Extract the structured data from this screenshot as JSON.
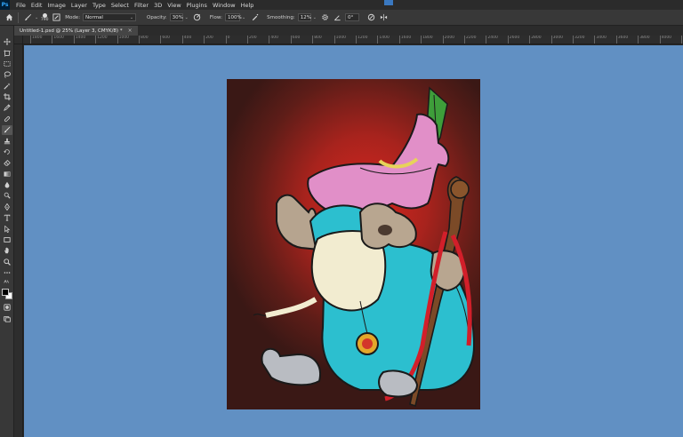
{
  "app": {
    "logo": "Ps"
  },
  "menu": [
    "File",
    "Edit",
    "Image",
    "Layer",
    "Type",
    "Select",
    "Filter",
    "3D",
    "View",
    "Plugins",
    "Window",
    "Help"
  ],
  "options": {
    "brush_size": "790",
    "mode_label": "Mode:",
    "mode_value": "Normal",
    "opacity_label": "Opacity:",
    "opacity_value": "30%",
    "flow_label": "Flow:",
    "flow_value": "100%",
    "smoothing_label": "Smoothing:",
    "smoothing_value": "12%",
    "angle_value": "0°"
  },
  "document": {
    "tab_title": "Untitled-1.psd @ 25% (Layer 3, CMYK/8) *",
    "close_glyph": "×"
  },
  "ruler": {
    "top_labels": [
      "1800",
      "1600",
      "1400",
      "1200",
      "1000",
      "800",
      "600",
      "400",
      "200",
      "0",
      "200",
      "400",
      "600",
      "800",
      "1000",
      "1200",
      "1400",
      "1600",
      "1800",
      "2000",
      "2200",
      "2400",
      "2600",
      "2800",
      "3000",
      "3200",
      "3400",
      "3600",
      "3800",
      "4000",
      "4200"
    ]
  },
  "tools": [
    "move-tool",
    "artboard-tool",
    "marquee-tool",
    "lasso-tool",
    "magic-wand-tool",
    "crop-tool",
    "eyedropper-tool",
    "healing-tool",
    "brush-tool",
    "clone-stamp-tool",
    "eraser-tool",
    "gradient-tool",
    "pen-tool",
    "type-tool",
    "path-selection-tool",
    "rectangle-tool",
    "hand-tool",
    "zoom-tool",
    "more-tools"
  ],
  "colors": {
    "workspace": "#6190c3",
    "foreground": "#000000",
    "background": "#ffffff",
    "accent": "#31a8ff"
  }
}
